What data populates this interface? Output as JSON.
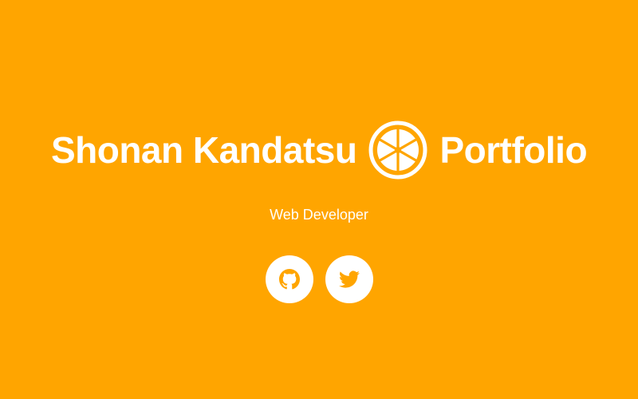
{
  "hero": {
    "title_first": "Shonan Kandatsu",
    "title_second": "Portfolio",
    "subtitle": "Web Developer",
    "logo_icon": "orange-slice-icon"
  },
  "social": [
    {
      "icon": "github-icon"
    },
    {
      "icon": "twitter-icon"
    }
  ],
  "colors": {
    "background": "#FFA500",
    "foreground": "#FFFFFF",
    "icon": "#FFA500"
  }
}
